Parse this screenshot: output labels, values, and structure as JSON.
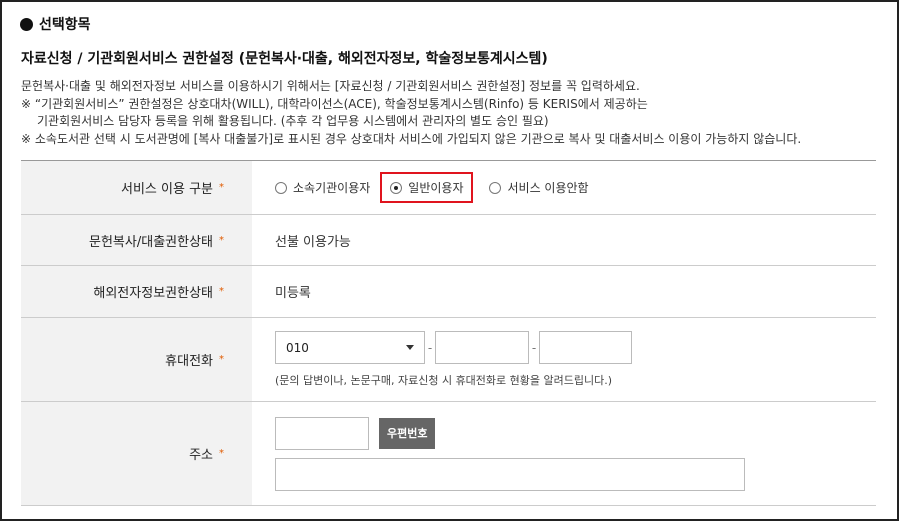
{
  "section": {
    "title": "선택항목"
  },
  "subtitle": "자료신청 / 기관회원서비스 권한설정 (문헌복사·대출, 해외전자정보, 학술정보통계시스템)",
  "notes": [
    "문헌복사·대출 및 해외전자정보 서비스를 이용하시기 위해서는 [자료신청 / 기관회원서비스 권한설정] 정보를 꼭 입력하세요.",
    "※ “기관회원서비스” 권한설정은 상호대차(WILL), 대학라이선스(ACE), 학술정보통계시스템(Rinfo) 등 KERIS에서 제공하는",
    "기관회원서비스 담당자 등록을 위해 활용됩니다. (추후 각 업무용 시스템에서 관리자의 별도 승인 필요)",
    "※ 소속도서관 선택 시 도서관명에 [복사 대출불가]로 표시된 경우 상호대차 서비스에 가입되지 않은 기관으로 복사 및 대출서비스 이용이 가능하지 않습니다."
  ],
  "form": {
    "required_mark": "*",
    "service_type": {
      "label": "서비스 이용 구분",
      "options": [
        "소속기관이용자",
        "일반이용자",
        "서비스 이용안함"
      ],
      "selected": "일반이용자"
    },
    "copy_loan_status": {
      "label": "문헌복사/대출권한상태",
      "value": "선불 이용가능"
    },
    "overseas_status": {
      "label": "해외전자정보권한상태",
      "value": "미등록"
    },
    "phone": {
      "label": "휴대전화",
      "prefix": "010",
      "help": "(문의 답변이나, 논문구매, 자료신청 시 휴대전화로 현황을 알려드립니다.)",
      "separator": "-"
    },
    "address": {
      "label": "주소",
      "zip_button": "우편번호"
    }
  },
  "colors": {
    "required": "#e05a00",
    "highlight": "#e0141e",
    "label_bg": "#f2f2f2"
  }
}
